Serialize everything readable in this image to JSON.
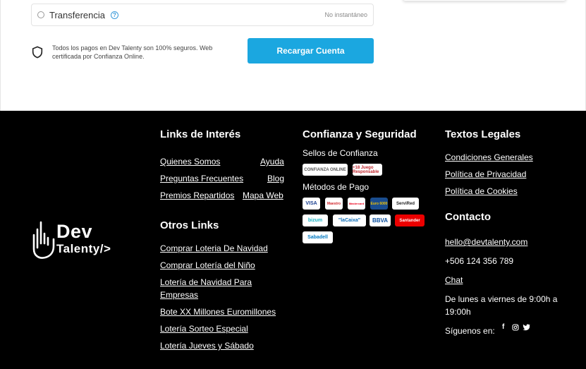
{
  "payment": {
    "option_label": "Transferencia",
    "option_note": "No instantáneo",
    "secure_text_line1": "Todos los pagos en Dev Talenty son 100% seguros. Web",
    "secure_text_line2": "certificada por Confianza Online.",
    "recharge_button": "Recargar Cuenta"
  },
  "logo": {
    "line1": "Dev",
    "line2": "Talenty/>"
  },
  "links_interes": {
    "title": "Links de Interés",
    "items": [
      "Quienes Somos",
      "Ayuda",
      "Preguntas Frecuentes",
      "Blog",
      "Premios Repartidos",
      "Mapa Web"
    ]
  },
  "otros_links": {
    "title": "Otros Links",
    "items": [
      "Comprar Loteria De Navidad",
      "Comprar Lotería del Niño",
      "Lotería de Navidad Para",
      "Empresas",
      "Bote XX Millones Euromillones",
      "Lotería Sorteo Especial",
      "Lotería Jueves y Sábado"
    ]
  },
  "confianza": {
    "title": "Confianza y Seguridad",
    "sellos_title": "Sellos de Confianza",
    "sellos": [
      "CONFIANZA ONLINE",
      "+18 Juego Responsable"
    ],
    "metodos_title": "Métodos de Pago",
    "metodos": [
      "VISA",
      "Maestro",
      "Mastercard",
      "Euro 6000",
      "ServiRed",
      "bizum",
      "\"laCaixa\"",
      "BBVA",
      "Santander",
      "Sabadell"
    ]
  },
  "legales": {
    "title": "Textos Legales",
    "items": [
      "Condiciones Generales",
      "Política de Privacidad",
      "Política de Cookies"
    ]
  },
  "contacto": {
    "title": "Contacto",
    "email": "hello@devtalenty.com",
    "phone": "+506 124 356 789",
    "chat": "Chat",
    "hours_line1": "De lunes a viernes de 9:00h a",
    "hours_line2": "19:00h",
    "follow": "Síguenos en:",
    "social": [
      "facebook-icon",
      "instagram-icon",
      "twitter-icon"
    ]
  },
  "colors": {
    "accent": "#1ba7e0",
    "footer_bg": "#000000"
  }
}
